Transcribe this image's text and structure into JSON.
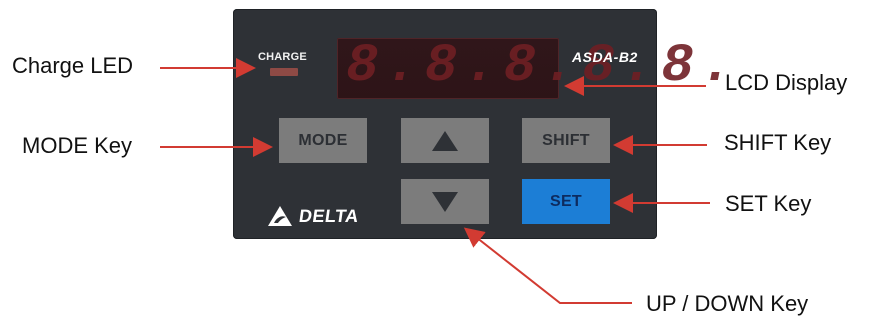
{
  "callouts": {
    "charge_led": "Charge LED",
    "lcd_display": "LCD Display",
    "mode_key": "MODE Key",
    "shift_key": "SHIFT Key",
    "set_key": "SET Key",
    "up_down_key": "UP / DOWN Key"
  },
  "panel": {
    "charge_label": "CHARGE",
    "display_value": "8.8.8.8.8.",
    "model_label": "ASDA-B2",
    "brand_label": "DELTA",
    "keys": {
      "mode": "MODE",
      "shift": "SHIFT",
      "set": "SET"
    }
  },
  "colors": {
    "panel_bg": "#2e3136",
    "led_off": "#8e4a45",
    "display_bg": "#2d1417",
    "digit_dim": "#6f1f24",
    "key_grey": "#7c7c7c",
    "key_blue": "#1c7ed6",
    "callout_red": "#d23b32"
  },
  "icons": {
    "up": "triangle-up-icon",
    "down": "triangle-down-icon",
    "brand": "delta-logo-icon"
  }
}
